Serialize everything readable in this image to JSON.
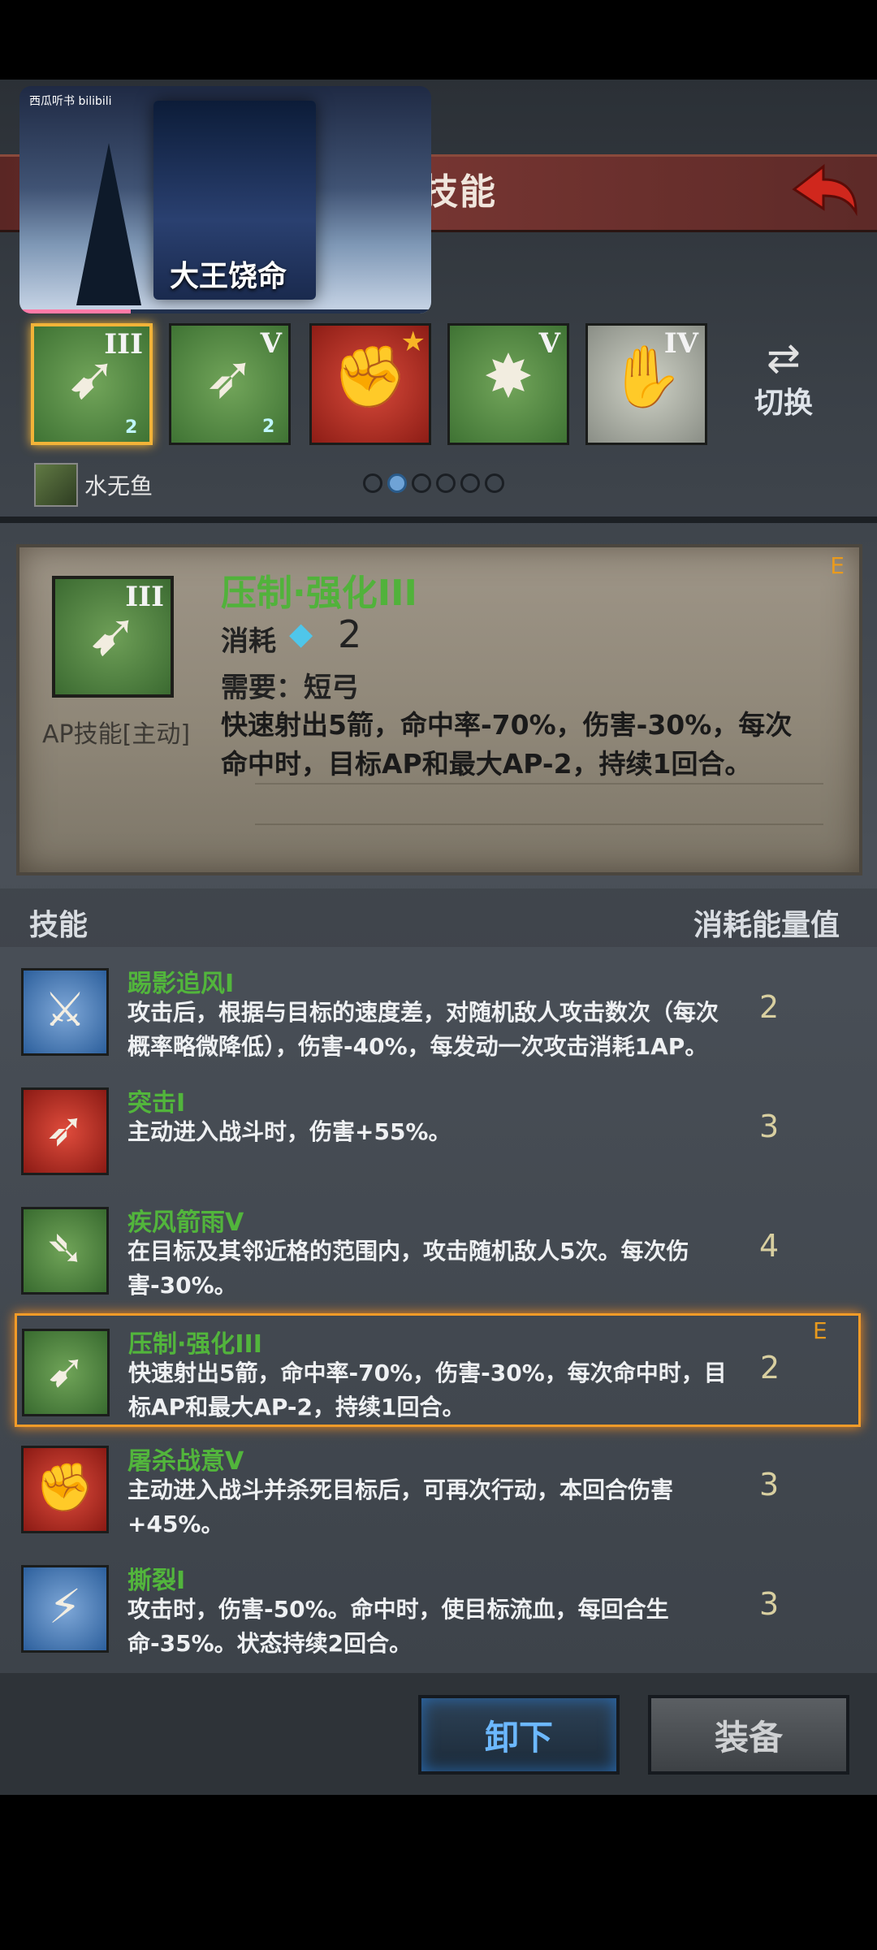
{
  "video": {
    "brand": "西瓜听书 bilibili",
    "poster_title": "大王饶命",
    "progress": 0.27
  },
  "header": {
    "title_partial": "技能",
    "back_icon": "back-arrow-icon"
  },
  "slots": [
    {
      "rank": "III",
      "glyph": "➹",
      "color": "green",
      "gem": "2",
      "selected": true
    },
    {
      "rank": "V",
      "glyph": "➶",
      "color": "green",
      "gem": "2",
      "selected": false
    },
    {
      "rank": "★",
      "glyph": "✊",
      "color": "red",
      "gem": "",
      "selected": false
    },
    {
      "rank": "V",
      "glyph": "✸",
      "color": "green",
      "gem": "",
      "selected": false
    },
    {
      "rank": "IV",
      "glyph": "✋",
      "color": "gray",
      "gem": "",
      "selected": false
    }
  ],
  "switch": {
    "label": "切换"
  },
  "owner": {
    "name": "水无鱼"
  },
  "pager": {
    "count": 6,
    "active": 1
  },
  "detail": {
    "rank": "III",
    "type": "AP技能[主动]",
    "name": "压制·强化III",
    "cost_label": "消耗",
    "cost_value": "2",
    "requirement": "需要：短弓",
    "description": "快速射出5箭，命中率-70%，伤害-30%，每次命中时，目标AP和最大AP-2，持续1回合。",
    "tag": "E"
  },
  "list_header": {
    "skill": "技能",
    "cost": "消耗能量值"
  },
  "skills": [
    {
      "name": "踢影追风I",
      "desc": "攻击后，根据与目标的速度差，对随机敌人攻击数次（每次概率略微降低），伤害-40%，每发动一次攻击消耗1AP。",
      "cost": "2",
      "color": "blue",
      "glyph": "⚔",
      "selected": false,
      "tag": ""
    },
    {
      "name": "突击I",
      "desc": "主动进入战斗时，伤害+55%。",
      "cost": "3",
      "color": "red",
      "glyph": "➶",
      "selected": false,
      "tag": ""
    },
    {
      "name": "疾风箭雨V",
      "desc": "在目标及其邻近格的范围内，攻击随机敌人5次。每次伤害-30%。",
      "cost": "4",
      "color": "green",
      "glyph": "➴",
      "selected": false,
      "tag": ""
    },
    {
      "name": "压制·强化III",
      "desc": "快速射出5箭，命中率-70%，伤害-30%，每次命中时，目标AP和最大AP-2，持续1回合。",
      "cost": "2",
      "color": "green",
      "glyph": "➹",
      "selected": true,
      "tag": "E"
    },
    {
      "name": "屠杀战意V",
      "desc": "主动进入战斗并杀死目标后，可再次行动，本回合伤害+45%。",
      "cost": "3",
      "color": "red",
      "glyph": "✊",
      "selected": false,
      "tag": ""
    },
    {
      "name": "撕裂I",
      "desc": "攻击时，伤害-50%。命中时，使目标流血，每回合生命-35%。状态持续2回合。",
      "cost": "3",
      "color": "blue",
      "glyph": "⚡",
      "selected": false,
      "tag": ""
    }
  ],
  "buttons": {
    "unload": "卸下",
    "equip": "装备"
  }
}
